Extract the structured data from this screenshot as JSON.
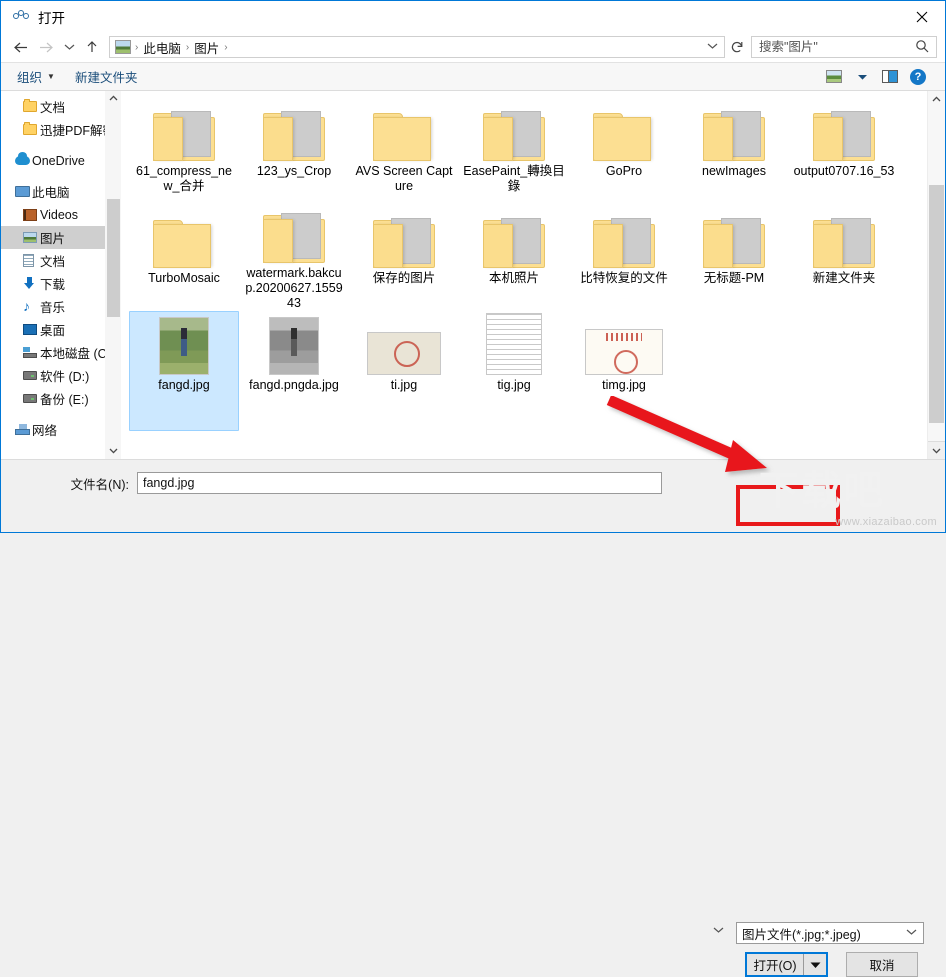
{
  "window": {
    "title": "打开",
    "title_icon": "open-dialog-icon",
    "close_label": "✕",
    "accent_color": "#0078d7"
  },
  "nav": {
    "back_icon": "arrow-left-icon",
    "forward_icon": "arrow-right-icon",
    "recent_icon": "chevron-down-icon",
    "up_icon": "arrow-up-icon",
    "breadcrumb_icon": "pictures-icon",
    "breadcrumb": [
      "此电脑",
      "图片"
    ],
    "separator": "›",
    "address_dropdown_icon": "chevron-down-icon",
    "refresh_icon": "refresh-icon",
    "search": {
      "placeholder": "搜索\"图片\"",
      "value": "",
      "icon": "search-icon"
    }
  },
  "toolbar": {
    "organize_label": "组织",
    "organize_caret": "▼",
    "new_folder_label": "新建文件夹",
    "view_icon": "view-mode-icon",
    "view_caret": "▼",
    "panes_icon": "preview-pane-icon",
    "help_icon": "help-icon",
    "help_glyph": "?"
  },
  "sidebar": {
    "scroll_up_icon": "chevron-up-icon",
    "scroll_down_icon": "chevron-down-icon",
    "items": [
      {
        "label": "文档",
        "icon": "folder-icon",
        "indent": true,
        "selected": false
      },
      {
        "label": "迅捷PDF解密",
        "icon": "folder-icon",
        "indent": true,
        "selected": false
      },
      {
        "label": "OneDrive",
        "icon": "cloud-icon",
        "indent": false,
        "selected": false
      },
      {
        "label": "此电脑",
        "icon": "this-pc-icon",
        "indent": false,
        "selected": false
      },
      {
        "label": "Videos",
        "icon": "videos-icon",
        "indent": true,
        "selected": false
      },
      {
        "label": "图片",
        "icon": "pictures-icon",
        "indent": true,
        "selected": true
      },
      {
        "label": "文档",
        "icon": "documents-icon",
        "indent": true,
        "selected": false
      },
      {
        "label": "下载",
        "icon": "downloads-icon",
        "indent": true,
        "selected": false
      },
      {
        "label": "音乐",
        "icon": "music-icon",
        "indent": true,
        "selected": false
      },
      {
        "label": "桌面",
        "icon": "desktop-icon",
        "indent": true,
        "selected": false
      },
      {
        "label": "本地磁盘 (C:)",
        "icon": "local-disk-icon",
        "indent": true,
        "selected": false
      },
      {
        "label": "软件 (D:)",
        "icon": "drive-icon",
        "indent": true,
        "selected": false
      },
      {
        "label": "备份 (E:)",
        "icon": "drive-icon",
        "indent": true,
        "selected": false
      },
      {
        "label": "网络",
        "icon": "network-icon",
        "indent": false,
        "selected": false
      }
    ]
  },
  "files": [
    {
      "name": "61_compress_new_合并",
      "kind": "folder",
      "thumb": "th-lake",
      "selected": false
    },
    {
      "name": "123_ys_Crop",
      "kind": "folder",
      "thumb": "th-lake2",
      "selected": false
    },
    {
      "name": "AVS Screen Capture",
      "kind": "folder",
      "thumb": "",
      "selected": false
    },
    {
      "name": "EasePaint_轉換目錄",
      "kind": "folder",
      "thumb": "th-dark",
      "selected": false
    },
    {
      "name": "GoPro",
      "kind": "folder",
      "thumb": "",
      "selected": false
    },
    {
      "name": "newImages",
      "kind": "folder",
      "thumb": "th-dark",
      "selected": false
    },
    {
      "name": "output0707.16_53",
      "kind": "folder",
      "thumb": "th-lake",
      "selected": false
    },
    {
      "name": "TurboMosaic",
      "kind": "folder",
      "thumb": "",
      "selected": false
    },
    {
      "name": "watermark.bakcup.20200627.155943",
      "kind": "folder",
      "thumb": "th-mount",
      "selected": false
    },
    {
      "name": "保存的图片",
      "kind": "folder",
      "thumb": "th-doc",
      "selected": false
    },
    {
      "name": "本机照片",
      "kind": "folder",
      "thumb": "th-blue",
      "selected": false
    },
    {
      "name": "比特恢复的文件",
      "kind": "folder",
      "thumb": "th-green",
      "selected": false
    },
    {
      "name": "无标题-PM",
      "kind": "folder",
      "thumb": "th-green",
      "selected": false
    },
    {
      "name": "新建文件夹",
      "kind": "folder",
      "thumb": "th-green",
      "selected": false
    },
    {
      "name": "fangd.jpg",
      "kind": "image",
      "thumb": "ph-girl",
      "selected": true
    },
    {
      "name": "fangd.pngda.jpg",
      "kind": "image",
      "thumb": "ph-gray",
      "selected": false
    },
    {
      "name": "ti.jpg",
      "kind": "image",
      "thumb": "ph-ticket",
      "selected": false
    },
    {
      "name": "tig.jpg",
      "kind": "image",
      "thumb": "ph-form",
      "selected": false
    },
    {
      "name": "timg.jpg",
      "kind": "image",
      "thumb": "ph-invoice",
      "selected": false
    }
  ],
  "content_scroll": {
    "up_icon": "chevron-up-icon",
    "down_icon": "chevron-down-icon"
  },
  "footer": {
    "filename_label": "文件名(N):",
    "filename_value": "fangd.jpg",
    "filename_placeholder": "",
    "filename_dropdown_icon": "chevron-down-icon",
    "filter_value": "图片文件(*.jpg;*.jpeg)",
    "filter_dropdown_icon": "chevron-down-icon",
    "open_label": "打开(O)",
    "open_split_icon": "caret-down-icon",
    "open_split_glyph": "▼",
    "cancel_label": "取消"
  },
  "annotations": {
    "highlight_color": "#e8191b",
    "arrow_name": "red-annotation-arrow",
    "rect_name": "red-annotation-rectangle"
  },
  "watermark": {
    "text": "www.xiazaibao.com",
    "big_text": "下载吧"
  }
}
